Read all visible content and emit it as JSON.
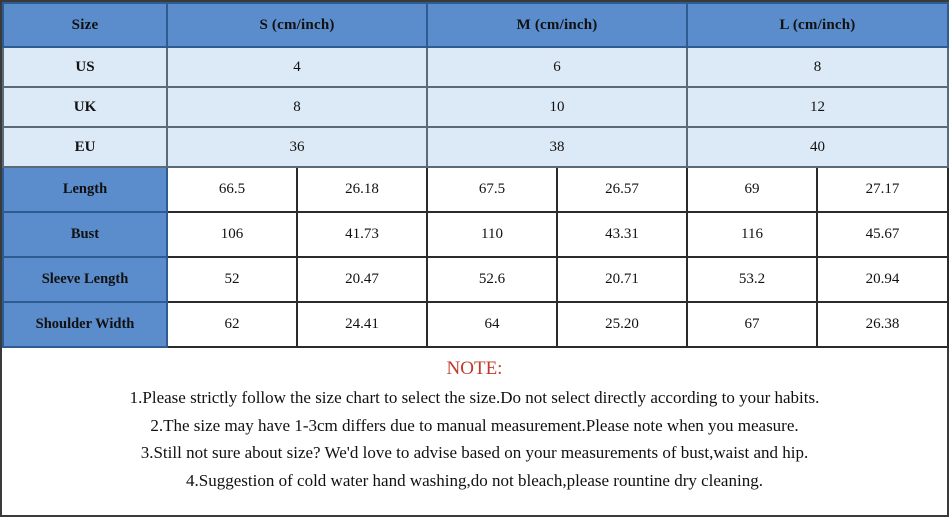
{
  "table": {
    "columns": [
      {
        "key": "label",
        "label": "Size"
      },
      {
        "key": "s",
        "label": "S (cm/inch)"
      },
      {
        "key": "m",
        "label": "M (cm/inch)"
      },
      {
        "key": "l",
        "label": "L (cm/inch)"
      }
    ],
    "conversion_rows": [
      {
        "label": "US",
        "s": "4",
        "m": "6",
        "l": "8"
      },
      {
        "label": "UK",
        "s": "8",
        "m": "10",
        "l": "12"
      },
      {
        "label": "EU",
        "s": "36",
        "m": "38",
        "l": "40"
      }
    ],
    "measurement_rows": [
      {
        "label": "Length",
        "s_cm": "66.5",
        "s_inch": "26.18",
        "m_cm": "67.5",
        "m_inch": "26.57",
        "l_cm": "69",
        "l_inch": "27.17"
      },
      {
        "label": "Bust",
        "s_cm": "106",
        "s_inch": "41.73",
        "m_cm": "110",
        "m_inch": "43.31",
        "l_cm": "116",
        "l_inch": "45.67"
      },
      {
        "label": "Sleeve Length",
        "s_cm": "52",
        "s_inch": "20.47",
        "m_cm": "52.6",
        "m_inch": "20.71",
        "l_cm": "53.2",
        "l_inch": "20.94"
      },
      {
        "label": "Shoulder Width",
        "s_cm": "62",
        "s_inch": "24.41",
        "m_cm": "64",
        "m_inch": "25.20",
        "l_cm": "67",
        "l_inch": "26.38"
      }
    ]
  },
  "note": {
    "title": "NOTE:",
    "lines": [
      "1.Please strictly follow the size chart to select the size.Do not select directly according to your habits.",
      "2.The size may have 1-3cm differs due to manual measurement.Please note when you measure.",
      "3.Still not sure about size? We'd love to advise based on your measurements of bust,waist and hip.",
      "4.Suggestion of cold water hand washing,do not bleach,please rountine dry cleaning."
    ]
  },
  "colors": {
    "header_blue": "#5b8ccb",
    "light_blue": "#dce9f6",
    "note_red": "#c0392b",
    "cell_white": "#ffffff",
    "border_dark": "#2b2b2b"
  }
}
